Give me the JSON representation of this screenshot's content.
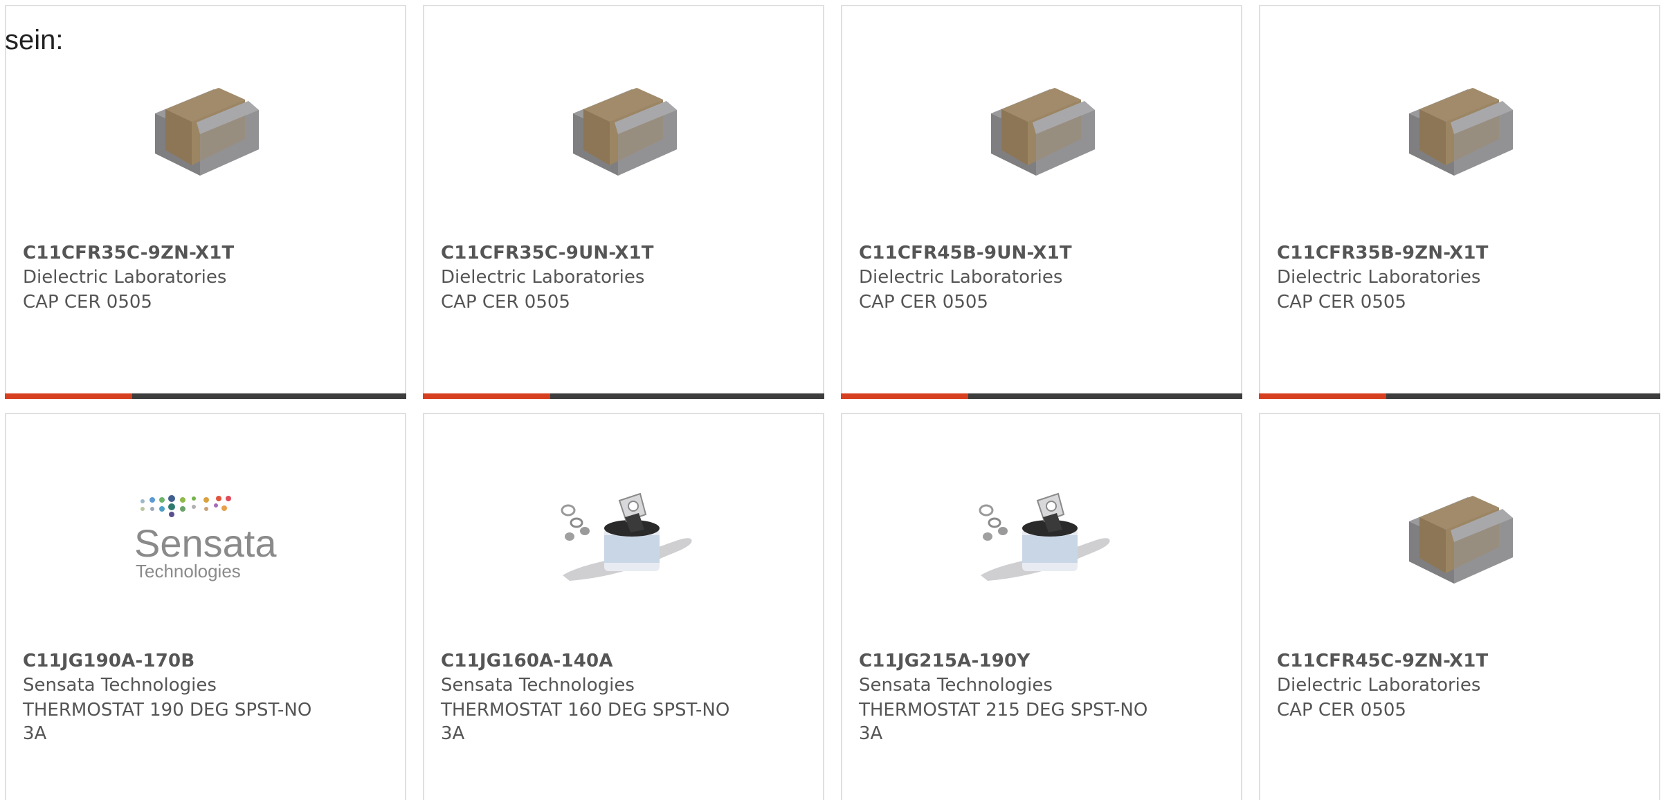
{
  "page": {
    "intro_text": "sein:"
  },
  "colors": {
    "accent": "#d63f1f",
    "bar_dark": "#3d3d3d",
    "card_border": "#e0e0e0",
    "text": "#555555"
  },
  "products": [
    {
      "part_number": "C11CFR35C-9ZN-X1T",
      "manufacturer": "Dielectric Laboratories",
      "description": "CAP CER 0505",
      "image": "ceramic-capacitor-image"
    },
    {
      "part_number": "C11CFR35C-9UN-X1T",
      "manufacturer": "Dielectric Laboratories",
      "description": "CAP CER 0505",
      "image": "ceramic-capacitor-image"
    },
    {
      "part_number": "C11CFR45B-9UN-X1T",
      "manufacturer": "Dielectric Laboratories",
      "description": "CAP CER 0505",
      "image": "ceramic-capacitor-image"
    },
    {
      "part_number": "C11CFR35B-9ZN-X1T",
      "manufacturer": "Dielectric Laboratories",
      "description": "CAP CER 0505",
      "image": "ceramic-capacitor-image"
    },
    {
      "part_number": "C11JG190A-170B",
      "manufacturer": "Sensata Technologies",
      "description": "THERMOSTAT 190 DEG SPST-NO 3A",
      "image": "sensata-logo-image",
      "logo_text": "Sensata",
      "logo_subtext": "Technologies"
    },
    {
      "part_number": "C11JG160A-140A",
      "manufacturer": "Sensata Technologies",
      "description": "THERMOSTAT 160 DEG SPST-NO 3A",
      "image": "thermostat-image"
    },
    {
      "part_number": "C11JG215A-190Y",
      "manufacturer": "Sensata Technologies",
      "description": "THERMOSTAT 215 DEG SPST-NO 3A",
      "image": "thermostat-image"
    },
    {
      "part_number": "C11CFR45C-9ZN-X1T",
      "manufacturer": "Dielectric Laboratories",
      "description": "CAP CER 0505",
      "image": "ceramic-capacitor-image"
    }
  ]
}
